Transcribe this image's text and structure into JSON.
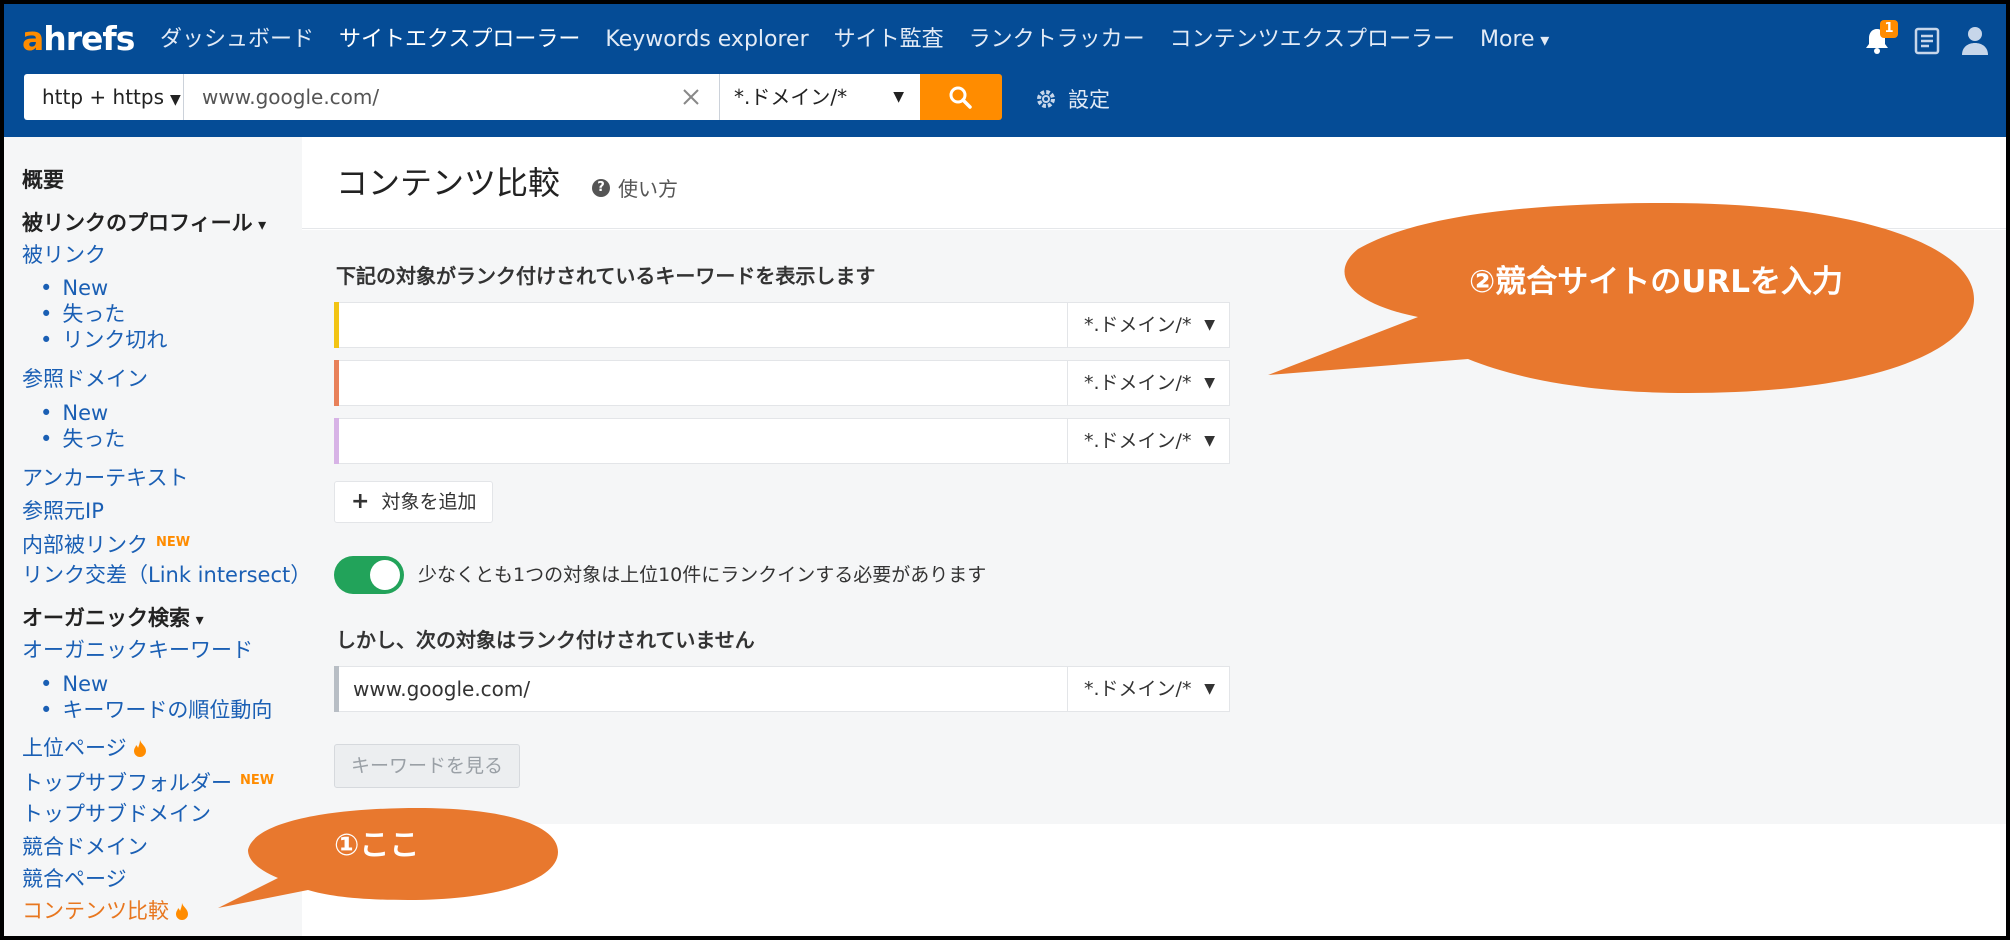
{
  "app": {
    "logo_a": "a",
    "logo_rest": "hrefs"
  },
  "nav": {
    "items": [
      {
        "label": "ダッシュボード"
      },
      {
        "label": "サイトエクスプローラー"
      },
      {
        "label": "Keywords explorer"
      },
      {
        "label": "サイト監査"
      },
      {
        "label": "ランクトラッカー"
      },
      {
        "label": "コンテンツエクスプローラー"
      },
      {
        "label": "More"
      }
    ],
    "notification_count": "1"
  },
  "search": {
    "protocol": "http + https",
    "url": "www.google.com/",
    "mode": "*.ドメイン/*",
    "settings_label": "設定"
  },
  "sidebar": {
    "items": [
      {
        "label": "概要"
      },
      {
        "label": "被リンクのプロフィール"
      },
      {
        "label": "被リンク"
      },
      {
        "label": "New"
      },
      {
        "label": "失った"
      },
      {
        "label": "リンク切れ"
      },
      {
        "label": "参照ドメイン"
      },
      {
        "label": "New"
      },
      {
        "label": "失った"
      },
      {
        "label": "アンカーテキスト"
      },
      {
        "label": "参照元IP"
      },
      {
        "label": "内部被リンク"
      },
      {
        "label": "リンク交差（Link intersect）"
      },
      {
        "label": "オーガニック検索"
      },
      {
        "label": "オーガニックキーワード"
      },
      {
        "label": "New"
      },
      {
        "label": "キーワードの順位動向"
      },
      {
        "label": "上位ページ"
      },
      {
        "label": "トップサブフォルダー"
      },
      {
        "label": "トップサブドメイン"
      },
      {
        "label": "競合ドメイン"
      },
      {
        "label": "競合ページ"
      },
      {
        "label": "コンテンツ比較"
      }
    ],
    "new_badge": "NEW"
  },
  "page": {
    "title": "コンテンツ比較",
    "help_label": "使い方"
  },
  "form": {
    "targets_label": "下記の対象がランク付けされているキーワードを表示します",
    "targets": [
      {
        "value": "",
        "mode": "*.ドメイン/*",
        "color": "#f2c414"
      },
      {
        "value": "",
        "mode": "*.ドメイン/*",
        "color": "#e8815a"
      },
      {
        "value": "",
        "mode": "*.ドメイン/*",
        "color": "#d7b3e6"
      }
    ],
    "add_target_label": "対象を追加",
    "toggle_label": "少なくとも1つの対象は上位10件にランクインする必要があります",
    "toggle_on": true,
    "exclude_label": "しかし、次の対象はランク付けされていません",
    "exclude": {
      "value": "www.google.com/",
      "mode": "*.ドメイン/*",
      "color": "#b8bec5"
    },
    "view_keywords_label": "キーワードを見る"
  },
  "annotations": {
    "callout_1": "①ここ",
    "callout_2": "②競合サイトのURLを入力",
    "color": "#e8782e"
  }
}
